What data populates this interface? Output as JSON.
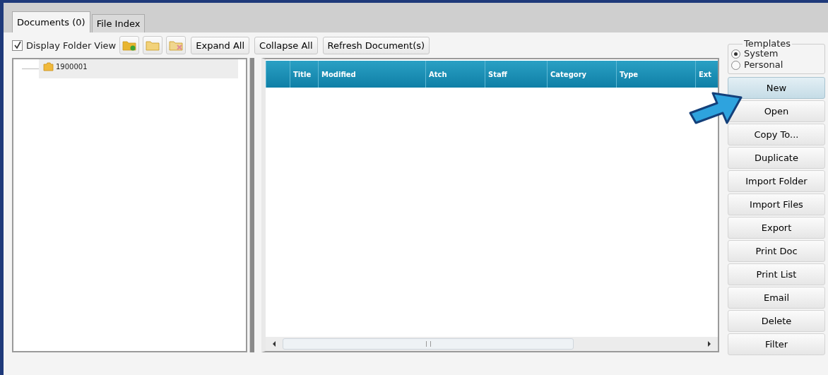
{
  "tabs": [
    {
      "label": "Documents (0)",
      "selected": true
    },
    {
      "label": "File Index",
      "selected": false
    }
  ],
  "toolbar": {
    "display_folder_view": {
      "label": "Display Folder View",
      "checked": true
    },
    "buttons": [
      {
        "kind": "new-folder"
      },
      {
        "kind": "folder"
      },
      {
        "kind": "delete-folder"
      },
      {
        "kind": "text",
        "label": "Expand All"
      },
      {
        "kind": "text",
        "label": "Collapse All"
      },
      {
        "kind": "text",
        "label": "Refresh Document(s)"
      }
    ]
  },
  "tree": {
    "items": [
      {
        "label": "1900001",
        "selected": true
      }
    ]
  },
  "table": {
    "columns": [
      "",
      "Title",
      "Modified",
      "Atch",
      "Staff",
      "Category",
      "Type",
      "Ext"
    ]
  },
  "templates": {
    "title": "Templates",
    "options": [
      {
        "label": "System",
        "selected": true
      },
      {
        "label": "Personal",
        "selected": false
      }
    ]
  },
  "actions": [
    {
      "label": "New",
      "highlighted": true
    },
    {
      "label": "Open",
      "highlighted": false
    },
    {
      "label": "Copy To...",
      "highlighted": false
    },
    {
      "label": "Duplicate",
      "highlighted": false
    },
    {
      "label": "Import Folder",
      "highlighted": false
    },
    {
      "label": "Import Files",
      "highlighted": false
    },
    {
      "label": "Export",
      "highlighted": false
    },
    {
      "label": "Print Doc",
      "highlighted": false
    },
    {
      "label": "Print List",
      "highlighted": false
    },
    {
      "label": "Email",
      "highlighted": false
    },
    {
      "label": "Delete",
      "highlighted": false
    },
    {
      "label": "Filter",
      "highlighted": false
    }
  ]
}
